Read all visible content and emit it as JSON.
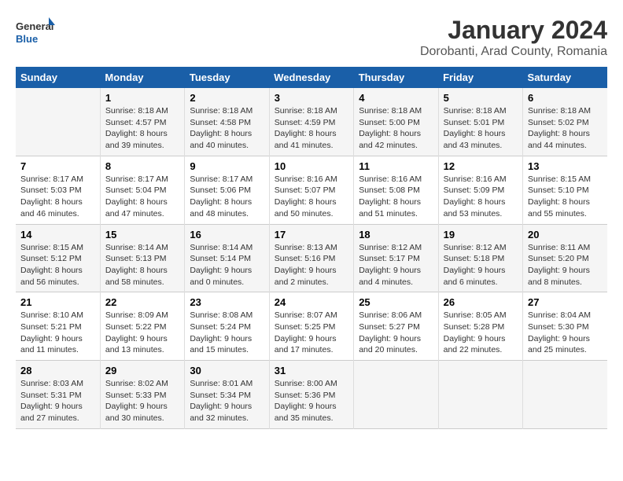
{
  "header": {
    "logo_line1": "General",
    "logo_line2": "Blue",
    "title": "January 2024",
    "subtitle": "Dorobanti, Arad County, Romania"
  },
  "days_of_week": [
    "Sunday",
    "Monday",
    "Tuesday",
    "Wednesday",
    "Thursday",
    "Friday",
    "Saturday"
  ],
  "weeks": [
    [
      {
        "day": "",
        "sunrise": "",
        "sunset": "",
        "daylight": ""
      },
      {
        "day": "1",
        "sunrise": "Sunrise: 8:18 AM",
        "sunset": "Sunset: 4:57 PM",
        "daylight": "Daylight: 8 hours and 39 minutes."
      },
      {
        "day": "2",
        "sunrise": "Sunrise: 8:18 AM",
        "sunset": "Sunset: 4:58 PM",
        "daylight": "Daylight: 8 hours and 40 minutes."
      },
      {
        "day": "3",
        "sunrise": "Sunrise: 8:18 AM",
        "sunset": "Sunset: 4:59 PM",
        "daylight": "Daylight: 8 hours and 41 minutes."
      },
      {
        "day": "4",
        "sunrise": "Sunrise: 8:18 AM",
        "sunset": "Sunset: 5:00 PM",
        "daylight": "Daylight: 8 hours and 42 minutes."
      },
      {
        "day": "5",
        "sunrise": "Sunrise: 8:18 AM",
        "sunset": "Sunset: 5:01 PM",
        "daylight": "Daylight: 8 hours and 43 minutes."
      },
      {
        "day": "6",
        "sunrise": "Sunrise: 8:18 AM",
        "sunset": "Sunset: 5:02 PM",
        "daylight": "Daylight: 8 hours and 44 minutes."
      }
    ],
    [
      {
        "day": "7",
        "sunrise": "Sunrise: 8:17 AM",
        "sunset": "Sunset: 5:03 PM",
        "daylight": "Daylight: 8 hours and 46 minutes."
      },
      {
        "day": "8",
        "sunrise": "Sunrise: 8:17 AM",
        "sunset": "Sunset: 5:04 PM",
        "daylight": "Daylight: 8 hours and 47 minutes."
      },
      {
        "day": "9",
        "sunrise": "Sunrise: 8:17 AM",
        "sunset": "Sunset: 5:06 PM",
        "daylight": "Daylight: 8 hours and 48 minutes."
      },
      {
        "day": "10",
        "sunrise": "Sunrise: 8:16 AM",
        "sunset": "Sunset: 5:07 PM",
        "daylight": "Daylight: 8 hours and 50 minutes."
      },
      {
        "day": "11",
        "sunrise": "Sunrise: 8:16 AM",
        "sunset": "Sunset: 5:08 PM",
        "daylight": "Daylight: 8 hours and 51 minutes."
      },
      {
        "day": "12",
        "sunrise": "Sunrise: 8:16 AM",
        "sunset": "Sunset: 5:09 PM",
        "daylight": "Daylight: 8 hours and 53 minutes."
      },
      {
        "day": "13",
        "sunrise": "Sunrise: 8:15 AM",
        "sunset": "Sunset: 5:10 PM",
        "daylight": "Daylight: 8 hours and 55 minutes."
      }
    ],
    [
      {
        "day": "14",
        "sunrise": "Sunrise: 8:15 AM",
        "sunset": "Sunset: 5:12 PM",
        "daylight": "Daylight: 8 hours and 56 minutes."
      },
      {
        "day": "15",
        "sunrise": "Sunrise: 8:14 AM",
        "sunset": "Sunset: 5:13 PM",
        "daylight": "Daylight: 8 hours and 58 minutes."
      },
      {
        "day": "16",
        "sunrise": "Sunrise: 8:14 AM",
        "sunset": "Sunset: 5:14 PM",
        "daylight": "Daylight: 9 hours and 0 minutes."
      },
      {
        "day": "17",
        "sunrise": "Sunrise: 8:13 AM",
        "sunset": "Sunset: 5:16 PM",
        "daylight": "Daylight: 9 hours and 2 minutes."
      },
      {
        "day": "18",
        "sunrise": "Sunrise: 8:12 AM",
        "sunset": "Sunset: 5:17 PM",
        "daylight": "Daylight: 9 hours and 4 minutes."
      },
      {
        "day": "19",
        "sunrise": "Sunrise: 8:12 AM",
        "sunset": "Sunset: 5:18 PM",
        "daylight": "Daylight: 9 hours and 6 minutes."
      },
      {
        "day": "20",
        "sunrise": "Sunrise: 8:11 AM",
        "sunset": "Sunset: 5:20 PM",
        "daylight": "Daylight: 9 hours and 8 minutes."
      }
    ],
    [
      {
        "day": "21",
        "sunrise": "Sunrise: 8:10 AM",
        "sunset": "Sunset: 5:21 PM",
        "daylight": "Daylight: 9 hours and 11 minutes."
      },
      {
        "day": "22",
        "sunrise": "Sunrise: 8:09 AM",
        "sunset": "Sunset: 5:22 PM",
        "daylight": "Daylight: 9 hours and 13 minutes."
      },
      {
        "day": "23",
        "sunrise": "Sunrise: 8:08 AM",
        "sunset": "Sunset: 5:24 PM",
        "daylight": "Daylight: 9 hours and 15 minutes."
      },
      {
        "day": "24",
        "sunrise": "Sunrise: 8:07 AM",
        "sunset": "Sunset: 5:25 PM",
        "daylight": "Daylight: 9 hours and 17 minutes."
      },
      {
        "day": "25",
        "sunrise": "Sunrise: 8:06 AM",
        "sunset": "Sunset: 5:27 PM",
        "daylight": "Daylight: 9 hours and 20 minutes."
      },
      {
        "day": "26",
        "sunrise": "Sunrise: 8:05 AM",
        "sunset": "Sunset: 5:28 PM",
        "daylight": "Daylight: 9 hours and 22 minutes."
      },
      {
        "day": "27",
        "sunrise": "Sunrise: 8:04 AM",
        "sunset": "Sunset: 5:30 PM",
        "daylight": "Daylight: 9 hours and 25 minutes."
      }
    ],
    [
      {
        "day": "28",
        "sunrise": "Sunrise: 8:03 AM",
        "sunset": "Sunset: 5:31 PM",
        "daylight": "Daylight: 9 hours and 27 minutes."
      },
      {
        "day": "29",
        "sunrise": "Sunrise: 8:02 AM",
        "sunset": "Sunset: 5:33 PM",
        "daylight": "Daylight: 9 hours and 30 minutes."
      },
      {
        "day": "30",
        "sunrise": "Sunrise: 8:01 AM",
        "sunset": "Sunset: 5:34 PM",
        "daylight": "Daylight: 9 hours and 32 minutes."
      },
      {
        "day": "31",
        "sunrise": "Sunrise: 8:00 AM",
        "sunset": "Sunset: 5:36 PM",
        "daylight": "Daylight: 9 hours and 35 minutes."
      },
      {
        "day": "",
        "sunrise": "",
        "sunset": "",
        "daylight": ""
      },
      {
        "day": "",
        "sunrise": "",
        "sunset": "",
        "daylight": ""
      },
      {
        "day": "",
        "sunrise": "",
        "sunset": "",
        "daylight": ""
      }
    ]
  ]
}
